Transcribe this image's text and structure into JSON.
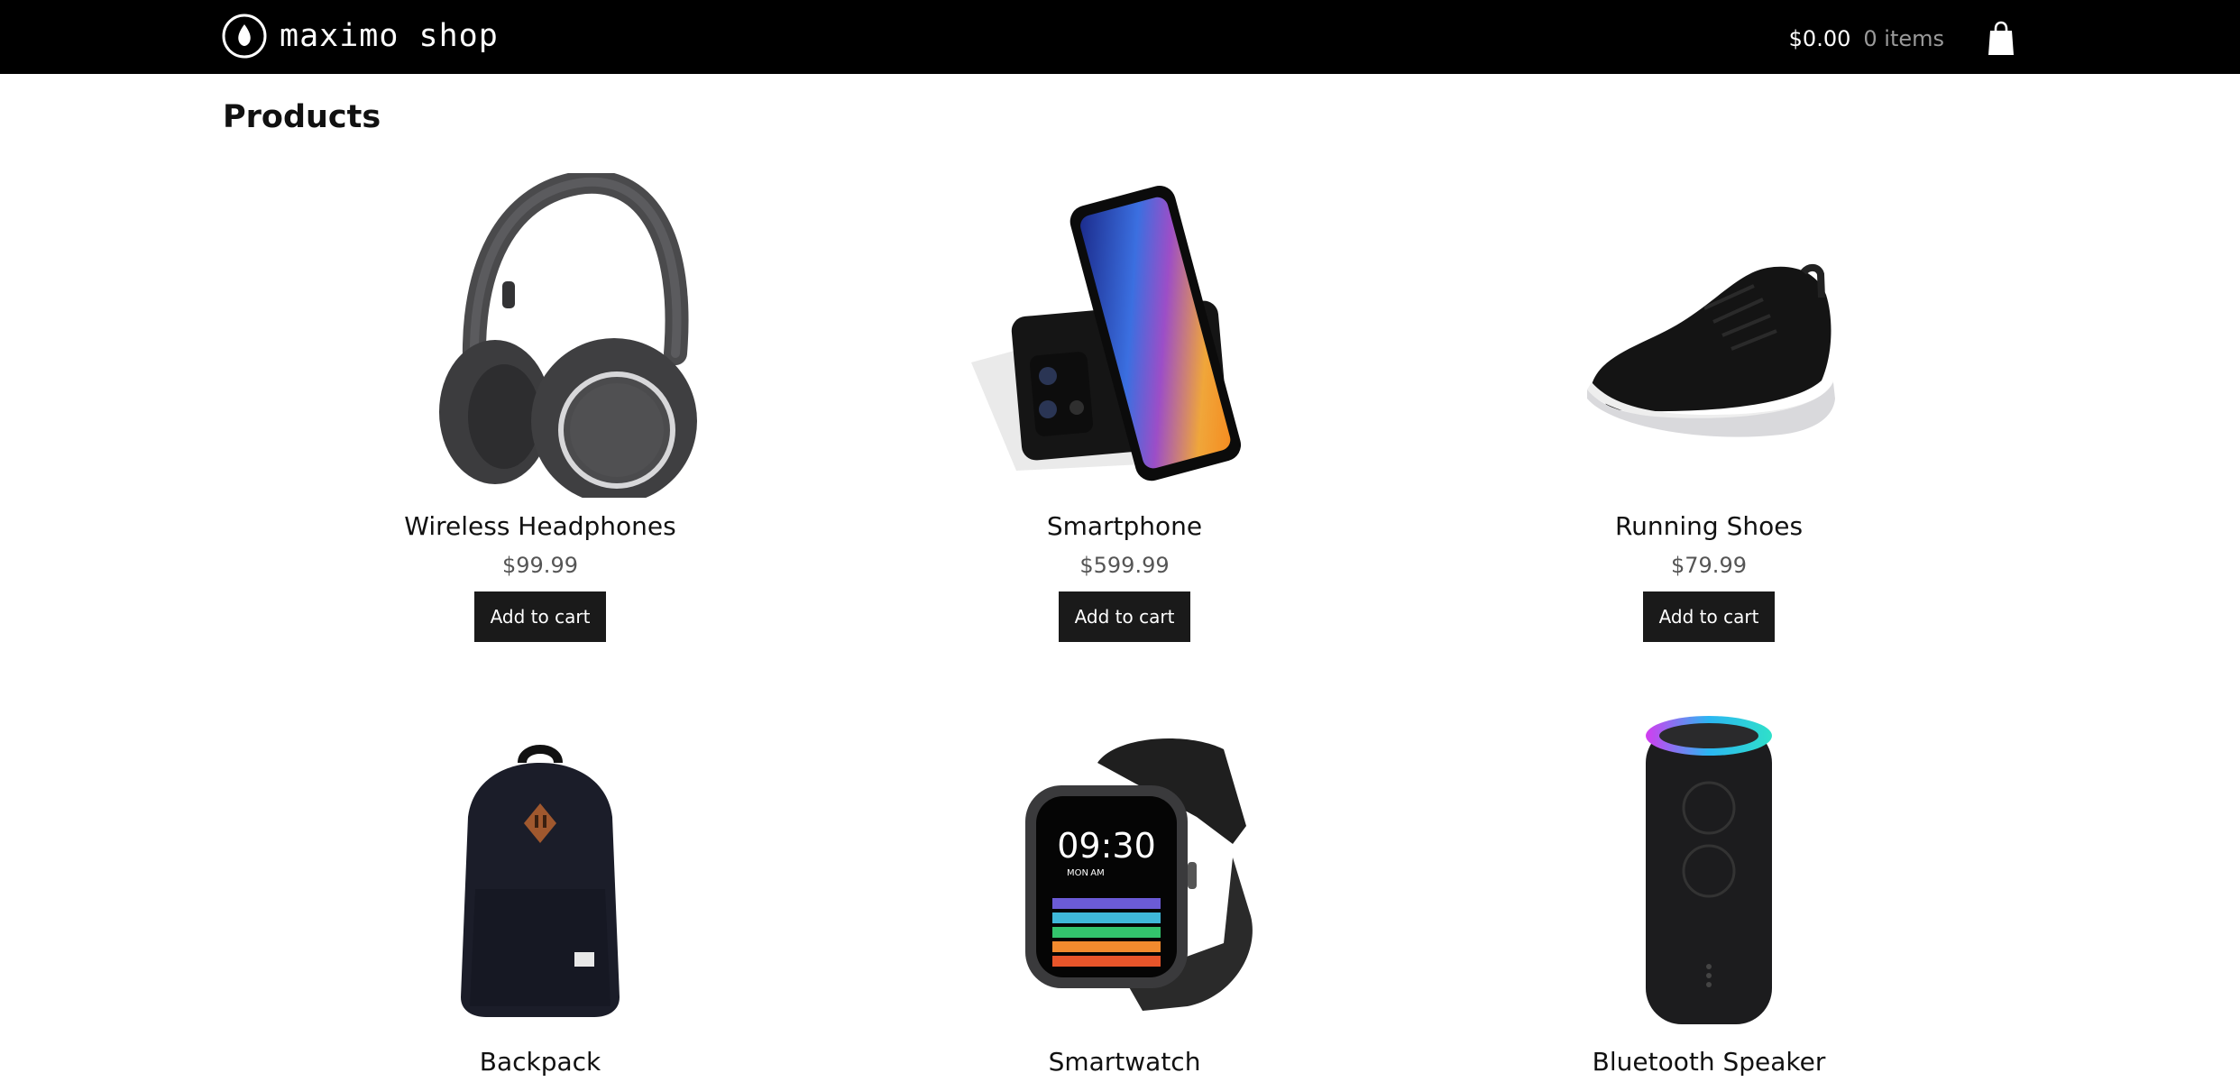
{
  "header": {
    "brand_name": "maximo shop",
    "brand_icon": "leaf-circle-icon",
    "cart_total": "$0.00",
    "cart_count": "0 items",
    "cart_icon": "shopping-bag-icon"
  },
  "main": {
    "title": "Products",
    "button_label": "Add to cart",
    "products": [
      {
        "name": "Wireless Headphones",
        "price": "$99.99",
        "image": "headphones"
      },
      {
        "name": "Smartphone",
        "price": "$599.99",
        "image": "smartphone"
      },
      {
        "name": "Running Shoes",
        "price": "$79.99",
        "image": "running-shoe"
      },
      {
        "name": "Backpack",
        "price": "",
        "image": "backpack"
      },
      {
        "name": "Smartwatch",
        "price": "",
        "image": "smartwatch",
        "watch_time": "09:30",
        "watch_day": "MON",
        "watch_ampm": "AM"
      },
      {
        "name": "Bluetooth Speaker",
        "price": "",
        "image": "speaker"
      }
    ]
  },
  "colors": {
    "topbar": "#000000",
    "button": "#1a1a1a",
    "price": "#555555"
  }
}
